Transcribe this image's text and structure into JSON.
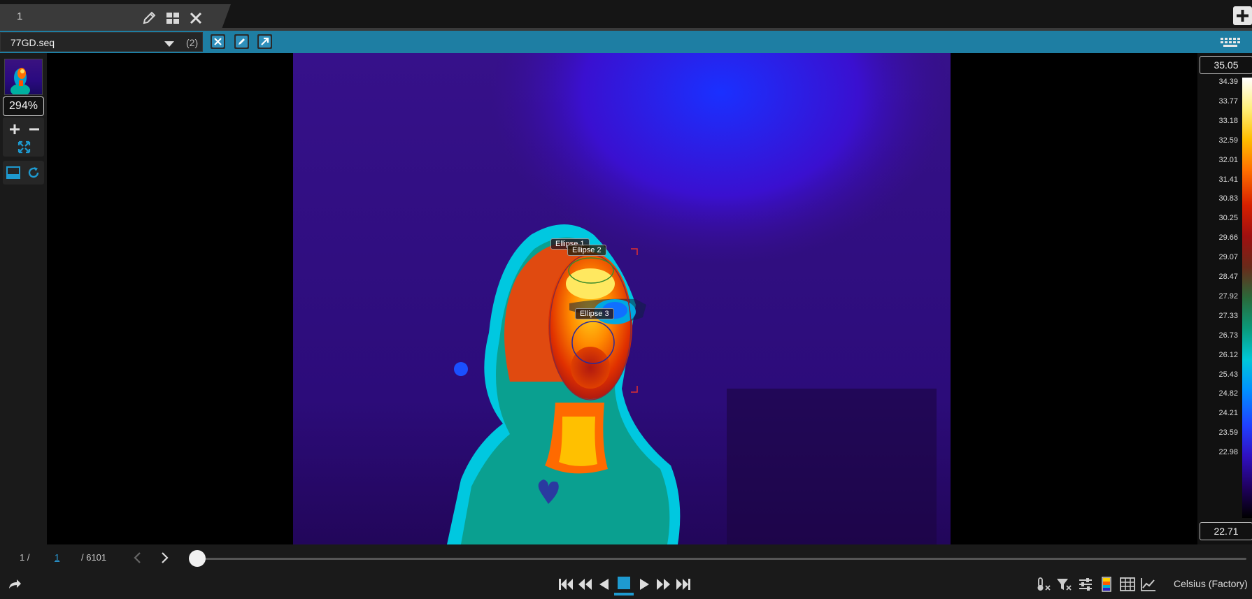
{
  "tabs": [
    {
      "label": "1"
    }
  ],
  "file": {
    "name": "77GD.seq",
    "count": "(2)"
  },
  "zoom": "294%",
  "scale": {
    "max": "35.05",
    "min": "22.71",
    "ticks": [
      "34.39",
      "33.77",
      "33.18",
      "32.59",
      "32.01",
      "31.41",
      "30.83",
      "30.25",
      "29.66",
      "29.07",
      "28.47",
      "27.92",
      "27.33",
      "26.73",
      "26.12",
      "25.43",
      "24.82",
      "24.21",
      "23.59",
      "22.98"
    ],
    "palette": [
      "#ffffff",
      "#fff07a",
      "#ffbe00",
      "#ff7000",
      "#d62000",
      "#a01010",
      "#6a2a1a",
      "#2a6a3a",
      "#0a9a7a",
      "#00c8d8",
      "#0090ff",
      "#2040ff",
      "#3010c0",
      "#200060",
      "#000000"
    ]
  },
  "annotations": [
    {
      "label": "Ellipse 1"
    },
    {
      "label": "Ellipse 2"
    },
    {
      "label": "Ellipse 3"
    }
  ],
  "timeline": {
    "current": "1 /",
    "frame": "1",
    "total": "/ 6101",
    "position": 0
  },
  "units": "Celsius (Factory)",
  "icons": {
    "tab": [
      "pencil-icon",
      "grid-icon",
      "close-icon"
    ],
    "filebar": [
      "close-icon",
      "edit-icon",
      "arrow-out-icon",
      "keyboard-icon"
    ],
    "left": [
      "zoom-in-icon",
      "zoom-out-icon",
      "fit-icon",
      "panel-icon",
      "refresh-icon"
    ],
    "playback": [
      "first-frame-icon",
      "rewind-icon",
      "step-back-icon",
      "stop-icon",
      "play-icon",
      "fast-forward-icon",
      "last-frame-icon"
    ],
    "tools": [
      "temperature-clear-icon",
      "filter-clear-icon",
      "sliders-icon",
      "palette-icon",
      "table-icon",
      "chart-icon"
    ]
  }
}
